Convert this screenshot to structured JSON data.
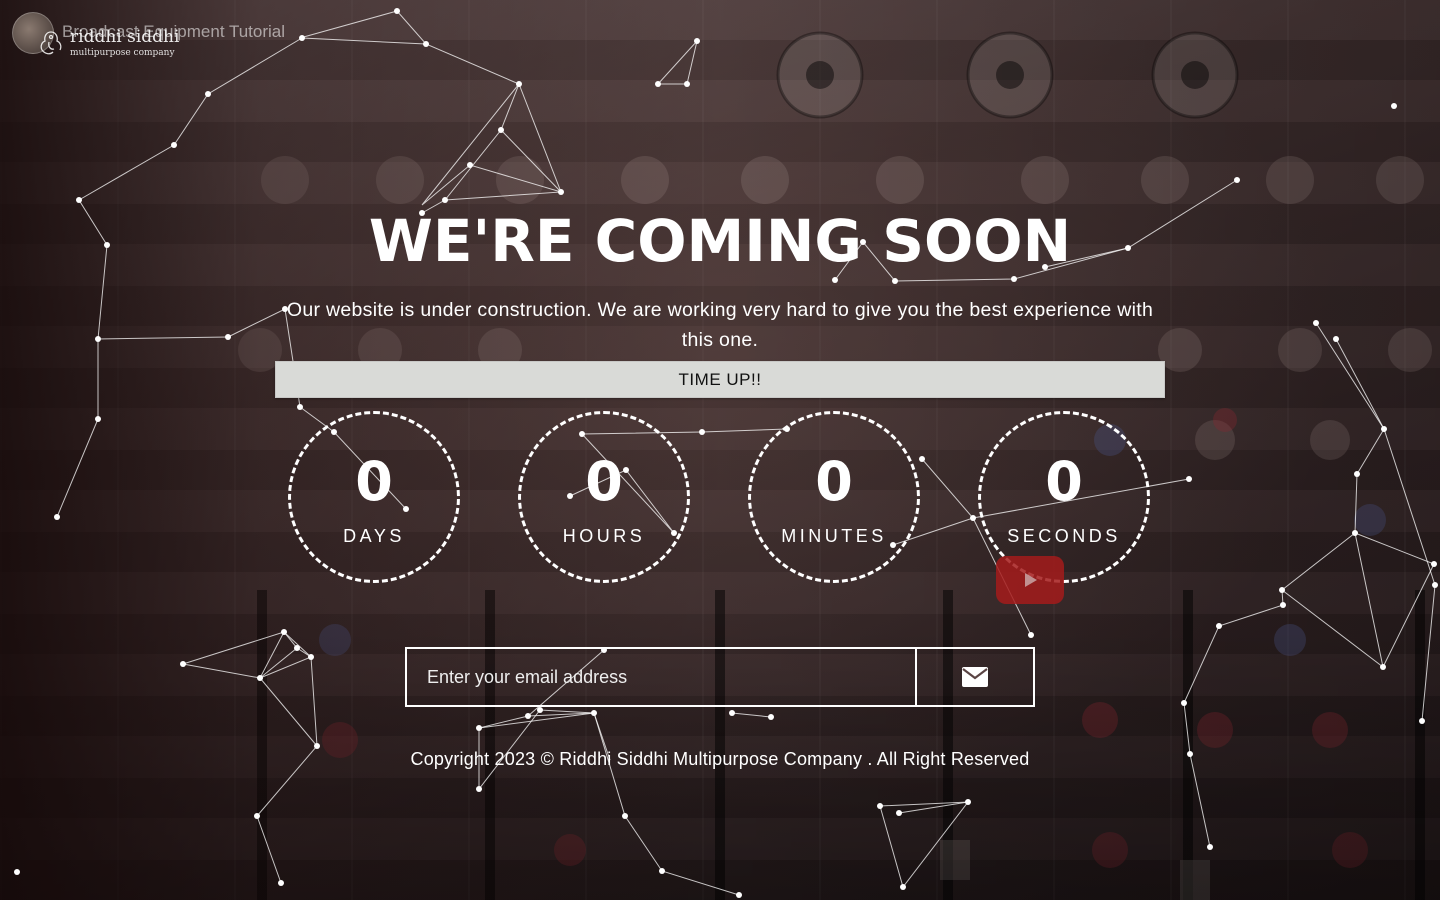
{
  "video": {
    "title": "Broadcast Equipment Tutorial"
  },
  "brand": {
    "name": "riddhi siddhi",
    "tagline": "multipurpose company"
  },
  "hero": {
    "heading": "WE'RE COMING SOON",
    "description": "Our website is under construction. We are working very hard to give you the best experience with this one."
  },
  "status": {
    "message": "TIME UP!!"
  },
  "countdown": [
    {
      "value": "0",
      "label": "DAYS"
    },
    {
      "value": "0",
      "label": "HOURS"
    },
    {
      "value": "0",
      "label": "MINUTES"
    },
    {
      "value": "0",
      "label": "SECONDS"
    }
  ],
  "subscribe": {
    "placeholder": "Enter your email address",
    "value": ""
  },
  "icons": {
    "submit": "envelope-icon",
    "video": "youtube-play-icon"
  },
  "colors": {
    "timeup_bar": "#d9dad7",
    "youtube_red": "#a41b1b"
  },
  "footer": {
    "copyright": "Copyright 2023 © Riddhi Siddhi Multipurpose Company . All Right Reserved"
  }
}
